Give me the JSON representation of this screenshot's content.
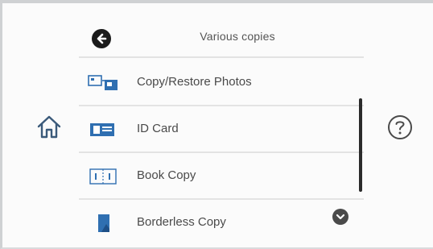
{
  "header": {
    "title": "Various copies",
    "back_icon": "back-arrow-icon"
  },
  "nav": {
    "home_icon": "home-icon",
    "help_icon": "help-icon"
  },
  "items": [
    {
      "label": "Copy/Restore Photos",
      "icon": "photo-copy-icon"
    },
    {
      "label": "ID Card",
      "icon": "id-card-icon"
    },
    {
      "label": "Book Copy",
      "icon": "book-copy-icon"
    },
    {
      "label": "Borderless Copy",
      "icon": "borderless-copy-icon"
    }
  ],
  "scroll": {
    "down_icon": "chevron-down-icon"
  },
  "colors": {
    "accent_blue": "#2f6fb1",
    "dark": "#1b1b1b"
  }
}
